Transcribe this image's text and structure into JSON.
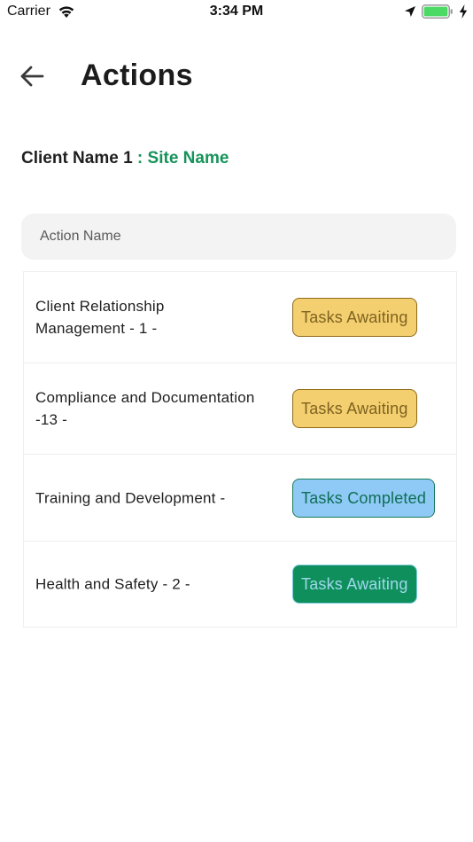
{
  "status_bar": {
    "carrier": "Carrier",
    "time": "3:34 PM"
  },
  "header": {
    "title": "Actions"
  },
  "client": {
    "client_name": "Client Name 1",
    "separator": " : ",
    "site_name": "Site Name"
  },
  "search": {
    "placeholder": "Action Name",
    "value": ""
  },
  "actions": [
    {
      "name": "Client Relationship Management - 1 -",
      "status": "Tasks Awaiting"
    },
    {
      "name": "Compliance and Documentation -13 -",
      "status": "Tasks Awaiting"
    },
    {
      "name": "Training and Development -",
      "status": "Tasks Completed"
    },
    {
      "name": "Health and Safety - 2 -",
      "status": "Tasks Awaiting"
    }
  ],
  "colors": {
    "accent_green": "#15935a",
    "awaiting_yellow": "#f3cf70",
    "completed_blue": "#8fcaf6",
    "awaiting_green": "#0f8f5c",
    "battery_green": "#4cd964"
  },
  "icons": {
    "status_bar": [
      "wifi-icon",
      "location-icon",
      "battery-icon",
      "charging-bolt-icon"
    ],
    "header": "back-arrow-icon"
  }
}
